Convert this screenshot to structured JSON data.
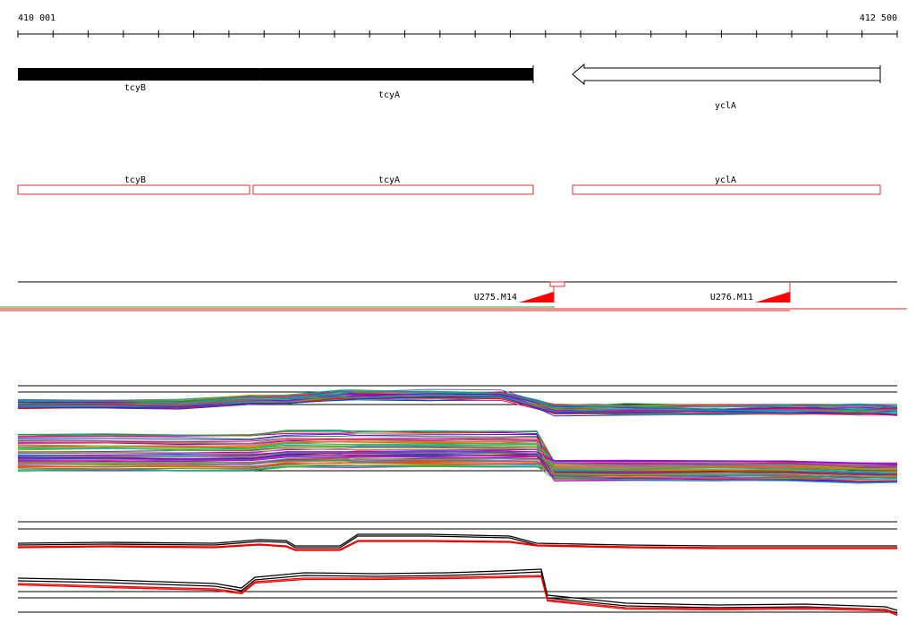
{
  "ruler": {
    "start_label": "410 001",
    "end_label": "412 500"
  },
  "genes": [
    {
      "name": "tcyB",
      "strand": "reverse",
      "filled": true
    },
    {
      "name": "tcyA",
      "strand": "reverse",
      "filled": true
    },
    {
      "name": "yclA",
      "strand": "reverse",
      "filled": false
    }
  ],
  "annotation_boxes": [
    {
      "label": "tcyB"
    },
    {
      "label": "tcyA"
    },
    {
      "label": "yclA"
    }
  ],
  "markers": [
    {
      "label": "U275.M14"
    },
    {
      "label": "U276.M11"
    }
  ],
  "colors": {
    "gene_filled": "#000000",
    "annotation_box": "#e03030",
    "marker": "#ff0000",
    "axis": "#000000"
  },
  "profile_palette": [
    "#d11",
    "#e08",
    "#a0c",
    "#70d",
    "#23c",
    "#09c",
    "#0aa",
    "#0a5",
    "#5b0",
    "#9a0",
    "#c80",
    "#e50",
    "#f33",
    "#c6c",
    "#66c",
    "#3a9"
  ]
}
